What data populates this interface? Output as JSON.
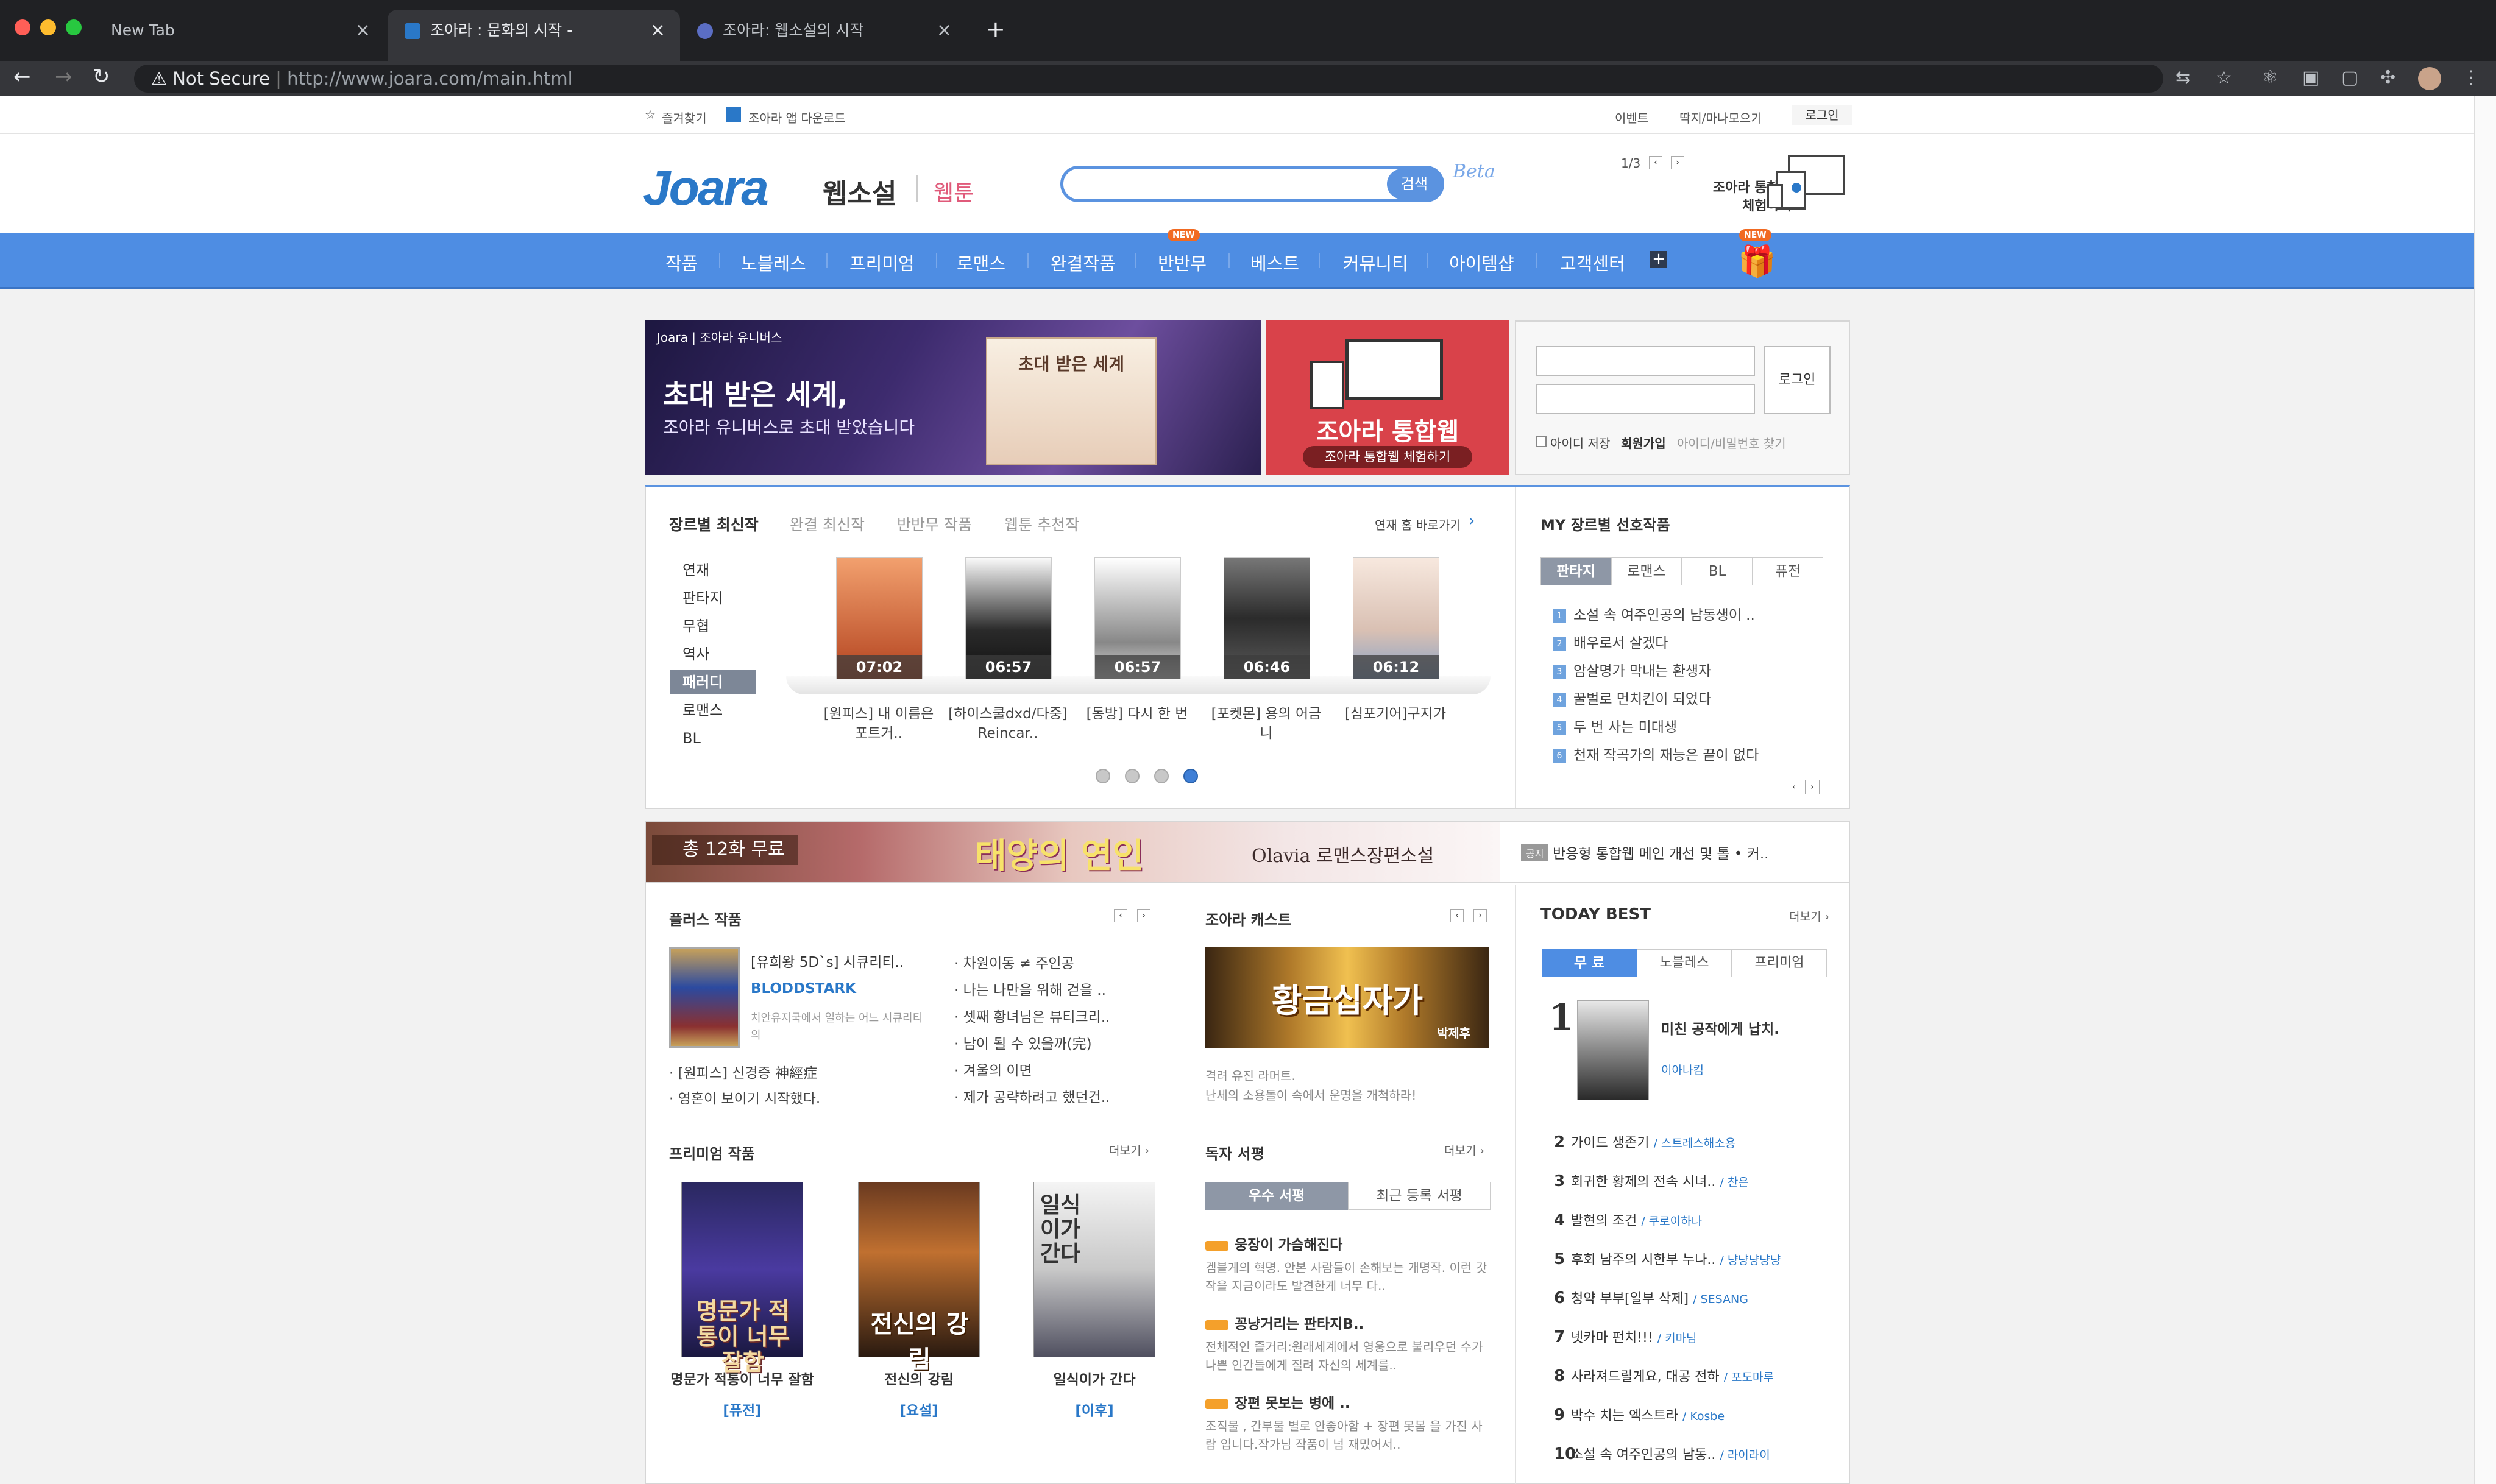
{
  "browser": {
    "tabs": [
      {
        "label": "New Tab"
      },
      {
        "label": "조아라 : 문화의 시작 -"
      },
      {
        "label": "조아라: 웹소설의 시작"
      }
    ],
    "security_label": "Not Secure",
    "url": "http://www.joara.com/main.html"
  },
  "topstrip": {
    "bookmark": "즐겨찾기",
    "app_download": "조아라 앱 다운로드",
    "event": "이벤트",
    "mine": "딱지/마나모으기",
    "login": "로그인"
  },
  "header": {
    "logo": "Joara",
    "webnovel": "웹소설",
    "webtoon": "웹툰",
    "search_btn": "검색",
    "beta": "Beta",
    "promo_page": "1/3",
    "promo_text1": "조아라 통합웹",
    "promo_text2": "체험하기"
  },
  "gnb": {
    "items": [
      "작품",
      "노블레스",
      "프리미엄",
      "로맨스",
      "완결작품",
      "반반무",
      "베스트",
      "커뮤니티",
      "아이템샵",
      "고객센터"
    ],
    "new_badge": "NEW"
  },
  "banners": {
    "b1_brand": "Joara | 조아라 유니버스",
    "b1_title": "초대 받은 세계,",
    "b1_sub": "조아라 유니버스로 초대 받았습니다",
    "b1_card": "초대 받은 세계",
    "b2_title": "조아라 통합웹",
    "b2_sub": "조아라 통합웹 체험하기"
  },
  "login_box": {
    "login_btn": "로그인",
    "save_id": "아이디 저장",
    "join": "회원가입",
    "find": "아이디/비밀번호 찾기"
  },
  "genre_section": {
    "tabs": [
      "장르별 최신작",
      "완결 최신작",
      "반반무 작품",
      "웹툰 추천작"
    ],
    "shortcut": "연재 홈 바로가기",
    "genres": [
      "연재",
      "판타지",
      "무협",
      "역사",
      "패러디",
      "로맨스",
      "BL"
    ],
    "books": [
      {
        "time": "07:02",
        "caption": "[원피스] 내 이름은 포트거.."
      },
      {
        "time": "06:57",
        "caption": "[하이스쿨dxd/다중] Reincar.."
      },
      {
        "time": "06:57",
        "caption": "[동방] 다시 한 번"
      },
      {
        "time": "06:46",
        "caption": "[포켓몬] 용의 어금니"
      },
      {
        "time": "06:12",
        "caption": "[심포기어]구지가"
      }
    ]
  },
  "my_genre": {
    "title": "MY 장르별 선호작품",
    "tabs": [
      "판타지",
      "로맨스",
      "BL",
      "퓨전"
    ],
    "items": [
      "소설 속 여주인공의 남동생이 ..",
      "배우로서 살겠다",
      "암살명가 막내는 환생자",
      "꿀벌로 먼치킨이 되었다",
      "두 번 사는 미대생",
      "천재 작곡가의 재능은 끝이 없다"
    ]
  },
  "strip_banner": {
    "free": "총 12화 무료",
    "title": "태양의 연인",
    "author": "Olavia 로맨스장편소설",
    "notice_badge": "공지",
    "notice": "반응형 통합웹 메인 개선 및 톨 • 커.."
  },
  "plus": {
    "title": "플러스 작품",
    "feature_title": "[유희왕 5D`s] 시큐리티..",
    "feature_author": "BLODDSTARK",
    "feature_desc": "치안유지국에서 일하는 어느 시큐리티의",
    "left_list": [
      "[원피스] 신경증 神經症",
      "영혼이 보이기 시작했다."
    ],
    "right_list": [
      "차원이동 ≠ 주인공",
      "나는 나만을 위해 걷을 ..",
      "셋째 황녀님은 뷰티크리..",
      "남이 될 수 있을까(完)",
      "겨울의 이면",
      "제가 공략하려고 했던건.."
    ]
  },
  "cast": {
    "title": "조아라 캐스트",
    "banner": "황금십자가",
    "author": "박제후",
    "desc1": "격려 유진 라머트.",
    "desc2": "난세의 소용돌이 속에서 운명을 개척하라!"
  },
  "premium": {
    "title": "프리미엄 작품",
    "more": "더보기 ›",
    "books": [
      {
        "title": "명문가 적통이 너무 잘함",
        "genre": "[퓨전]",
        "cover": "명문가 적통이 너무 잘함"
      },
      {
        "title": "전신의 강림",
        "genre": "[요설]",
        "cover": "전신의 강림"
      },
      {
        "title": "일식이가 간다",
        "genre": "[이후]",
        "cover": "일식이가 간다"
      }
    ]
  },
  "reviews": {
    "title": "독자 서평",
    "more": "더보기 ›",
    "tabs": [
      "우수 서평",
      "최근 등록 서평"
    ],
    "items": [
      {
        "title": "웅장이 가슴해진다",
        "body": "겜블게의 혁명. 안본 사람들이 손해보는 개명작. 이런 갓 작을 지금이라도 발견한게 너무 다.."
      },
      {
        "title": "꽁냥거리는 판타지B..",
        "body": "전체적인 즐거리:원래세계에서 영웅으로 불리우던 수가 나쁜 인간들에게 질려 자신의 세계를.."
      },
      {
        "title": "장편 못보는 병에 ..",
        "body": "조직물 , 간부물 별로 안좋아함 + 장편 못봄 을 가진 사람 입니다.작가님 작품이 넘 재밌어서.."
      }
    ]
  },
  "today_best": {
    "title": "TODAY BEST",
    "more": "더보기 ›",
    "tabs": [
      "무 료",
      "노블레스",
      "프리미엄"
    ],
    "first": {
      "rank": "1",
      "title": "미친 공작에게 납치.",
      "author": "이아나킴"
    },
    "items": [
      {
        "rank": "2",
        "title": "가이드 생존기",
        "author": "/ 스트레스해소용"
      },
      {
        "rank": "3",
        "title": "회귀한 황제의 전속 시녀..",
        "author": "/ 찬은"
      },
      {
        "rank": "4",
        "title": "발현의 조건",
        "author": "/ 쿠로이하나"
      },
      {
        "rank": "5",
        "title": "후회 남주의 시한부 누나..",
        "author": "/ 냥냥냥냥냥"
      },
      {
        "rank": "6",
        "title": "청약 부부[일부 삭제]",
        "author": "/ SESANG"
      },
      {
        "rank": "7",
        "title": "넷카마 펀치!!!",
        "author": "/ 키마님"
      },
      {
        "rank": "8",
        "title": "사라져드릴게요, 대공 전하",
        "author": "/ 포도마루"
      },
      {
        "rank": "9",
        "title": "박수 치는 엑스트라",
        "author": "/ Kosbe"
      },
      {
        "rank": "10",
        "title": "소설 속 여주인공의 남동..",
        "author": "/ 라이라이"
      }
    ]
  },
  "colors": {
    "accent": "#4e8de3",
    "brand": "#2a78c8",
    "badge": "#f16a22"
  }
}
